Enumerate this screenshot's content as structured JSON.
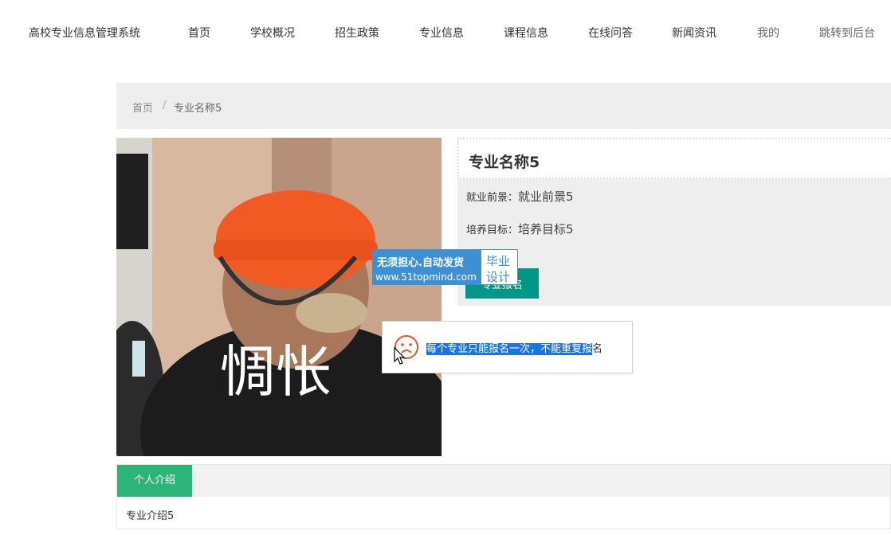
{
  "nav": {
    "brand": "高校专业信息管理系统",
    "items": [
      "首页",
      "学校概况",
      "招生政策",
      "专业信息",
      "课程信息",
      "在线问答",
      "新闻资讯",
      "我的",
      "跳转到后台"
    ]
  },
  "breadcrumb": {
    "home": "首页",
    "separator": "/",
    "current": "专业名称5"
  },
  "photo": {
    "caption": "惆怅"
  },
  "detail": {
    "title": "专业名称5",
    "career_label": "就业前景：",
    "career_value": "就业前景5",
    "goal_label": "培养目标：",
    "goal_value": "培养目标5",
    "apply_button": "专业报名"
  },
  "watermark": {
    "line1": "无须担心.自动发货",
    "line2": "www.51topmind.com",
    "right1": "毕业",
    "right2": "设计"
  },
  "toast": {
    "selected_text": "每个专业只能报名一次，不能重复报",
    "rest_text": "名",
    "icon": "sad-face-icon",
    "icon_color": "#e0542c"
  },
  "intro": {
    "tab_label": "个人介绍",
    "content": "专业介绍5"
  },
  "colors": {
    "accent_teal": "#009688",
    "tab_green": "#2db479",
    "watermark_blue": "#3d8fd6"
  }
}
